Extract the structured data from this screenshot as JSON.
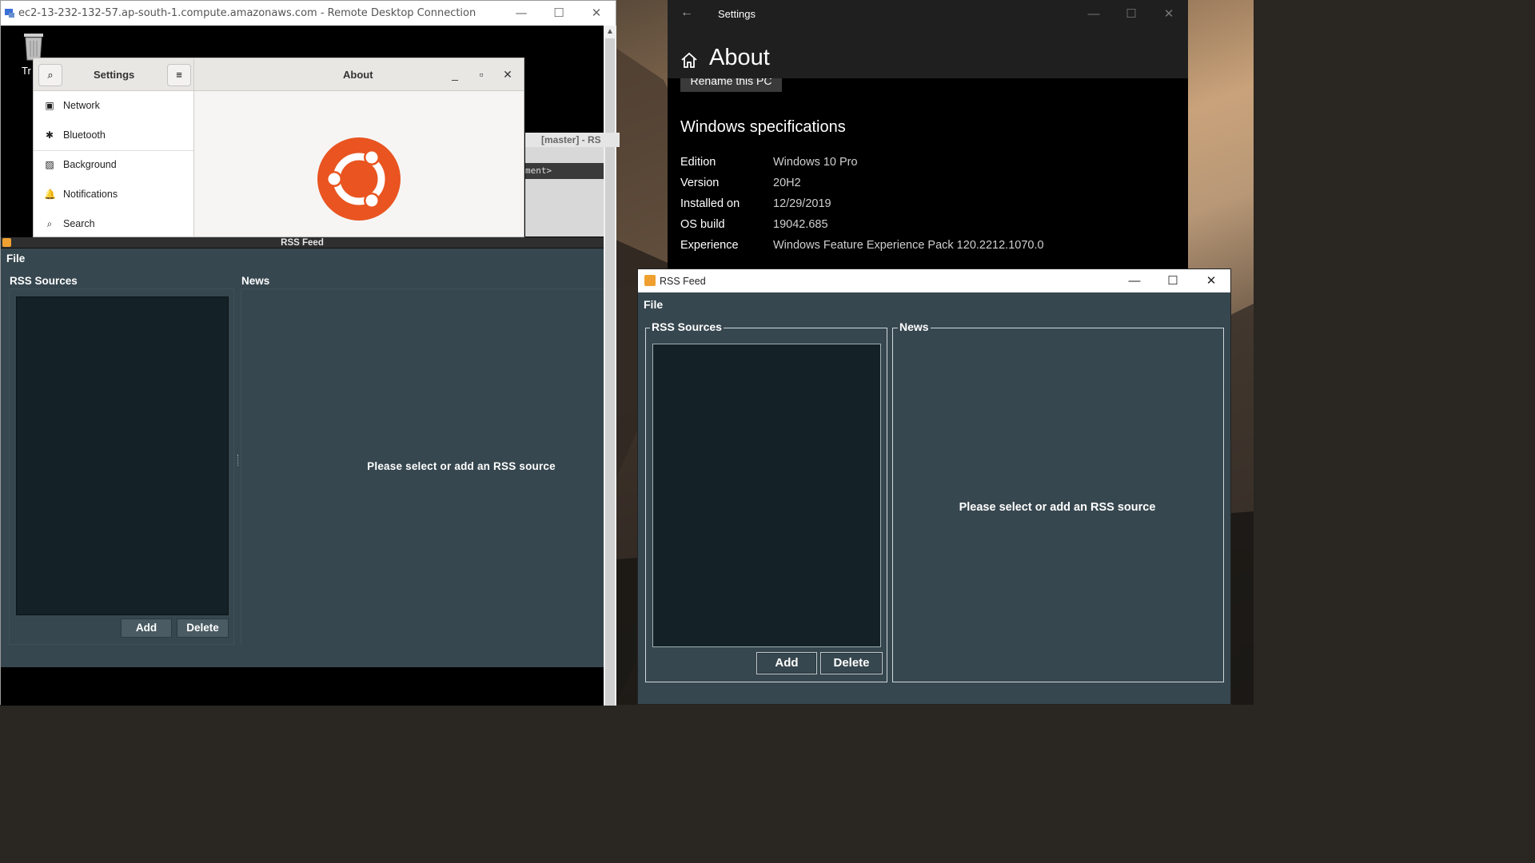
{
  "rdp": {
    "title": "ec2-13-232-132-57.ap-south-1.compute.amazonaws.com - Remote Desktop Connection",
    "controls": {
      "minimize": "—",
      "maximize": "☐",
      "close": "✕"
    }
  },
  "remote_desktop": {
    "trash_label": "Tr",
    "terminal": {
      "header": "[master] - RS",
      "line": "ment>"
    }
  },
  "gnome_settings": {
    "title": "Settings",
    "panel_title": "About",
    "controls": {
      "minimize": "_",
      "maximize": "▫",
      "close": "✕"
    },
    "search_icon": "⌕",
    "menu_icon": "≡",
    "sidebar": [
      {
        "icon": "network-icon",
        "glyph": "▣",
        "label": "Network"
      },
      {
        "icon": "bluetooth-icon",
        "glyph": "✱",
        "label": "Bluetooth"
      },
      {
        "icon": "background-icon",
        "glyph": "▨",
        "label": "Background"
      },
      {
        "icon": "notifications-icon",
        "glyph": "🔔",
        "label": "Notifications"
      },
      {
        "icon": "search-icon",
        "glyph": "⌕",
        "label": "Search"
      }
    ]
  },
  "linux_rss": {
    "title": "RSS Feed",
    "menu_file": "File",
    "sources_title": "RSS Sources",
    "news_title": "News",
    "add_label": "Add",
    "delete_label": "Delete",
    "message": "Please select or add an RSS source"
  },
  "windows_settings": {
    "title": "Settings",
    "back_glyph": "←",
    "controls": {
      "minimize": "—",
      "maximize": "☐",
      "close": "✕"
    },
    "page_title": "About",
    "rename_button": "Rename this PC",
    "specs_title": "Windows specifications",
    "specs": [
      {
        "key": "Edition",
        "value": "Windows 10 Pro"
      },
      {
        "key": "Version",
        "value": "20H2"
      },
      {
        "key": "Installed on",
        "value": "12/29/2019"
      },
      {
        "key": "OS build",
        "value": "19042.685"
      },
      {
        "key": "Experience",
        "value": "Windows Feature Experience Pack 120.2212.1070.0"
      }
    ]
  },
  "windows_rss": {
    "title": "RSS Feed",
    "controls": {
      "minimize": "—",
      "maximize": "☐",
      "close": "✕"
    },
    "menu_file": "File",
    "sources_title": "RSS Sources",
    "news_title": "News",
    "add_label": "Add",
    "delete_label": "Delete",
    "message": "Please select or add an RSS source"
  },
  "colors": {
    "rss_background": "#37474f",
    "rss_list_background": "#142126",
    "ubuntu_orange": "#e95420"
  }
}
